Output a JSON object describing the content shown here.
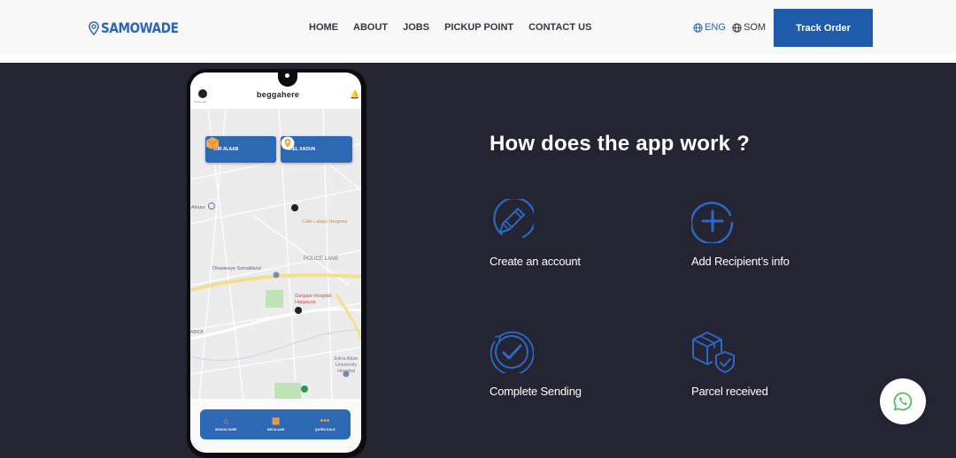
{
  "header": {
    "logo": {
      "icon": "map-pin-icon",
      "text": "SAMOWADE"
    },
    "nav": [
      {
        "label": "HOME"
      },
      {
        "label": "ABOUT"
      },
      {
        "label": "JOBS"
      },
      {
        "label": "PICKUP POINT"
      },
      {
        "label": "CONTACT US"
      }
    ],
    "languages": [
      {
        "icon": "globe-icon",
        "label": "ENG",
        "active": true
      },
      {
        "icon": "globe-icon",
        "label": "SOM",
        "active": false
      }
    ],
    "track_button": "Track Order"
  },
  "colors": {
    "brand_blue": "#1f5aab",
    "logo_blue": "#2b64b8",
    "section_bg": "#252433",
    "header_bg": "#f9f9f9",
    "icon_blue": "#2b6ac4",
    "whatsapp_green": "#4cc25a"
  },
  "phone": {
    "app_title": "beggahere",
    "avatar_label": "Guest user",
    "action_buttons": [
      {
        "icon": "box-icon",
        "label": "DIR ALAAB"
      },
      {
        "icon": "location-pin-icon",
        "label": "HEL XADUN"
      }
    ],
    "map_labels": [
      {
        "text": "Alnuur",
        "color": "#666"
      },
      {
        "text": "Cafe Lalays Hargesa",
        "color": "#d08a3a"
      },
      {
        "text": "POLICE LANE",
        "color": "#6f7b8f"
      },
      {
        "text": "Dhaweeye Somaliland",
        "color": "#5a6a80"
      },
      {
        "text": "Gargaar Hospital Hargaysa",
        "color": "#d04a4a"
      },
      {
        "text": "ABKA",
        "color": "#6f7b8f"
      },
      {
        "text": "Edna Adan University Hospital",
        "color": "#6f7b8f"
      }
    ],
    "bottom_nav": [
      {
        "icon": "home-icon",
        "label": "BOGGA HORE"
      },
      {
        "icon": "box-icon",
        "label": "DIR ALAAB"
      },
      {
        "icon": "more-icon",
        "label": "QAYBO KALE"
      }
    ]
  },
  "section": {
    "title": "How does the app work ?",
    "steps": [
      {
        "icon": "pencil-circle-icon",
        "label": "Create an account"
      },
      {
        "icon": "plus-circle-icon",
        "label": "Add Recipient’s info"
      },
      {
        "icon": "check-clock-icon",
        "label": "Complete Sending"
      },
      {
        "icon": "parcel-shield-icon",
        "label": "Parcel received"
      }
    ]
  },
  "whatsapp": {
    "icon": "whatsapp-icon"
  }
}
